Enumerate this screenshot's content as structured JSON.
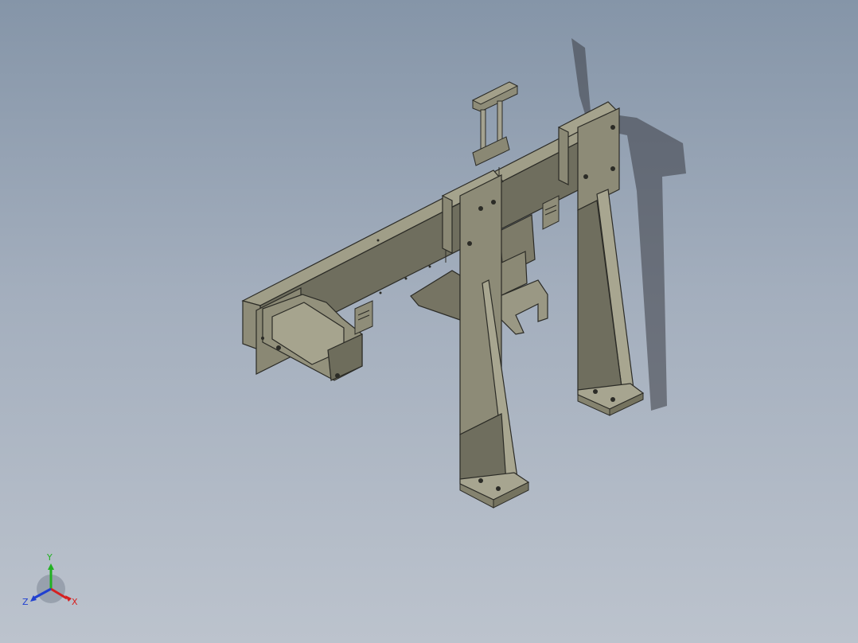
{
  "viewport": {
    "background_top": "#8595a8",
    "background_bottom": "#bcc3cd",
    "model_color": "#84826f"
  },
  "triad": {
    "x_label": "X",
    "y_label": "Y",
    "z_label": "Z",
    "x_color": "#d62020",
    "y_color": "#22b022",
    "z_color": "#2040d0"
  }
}
